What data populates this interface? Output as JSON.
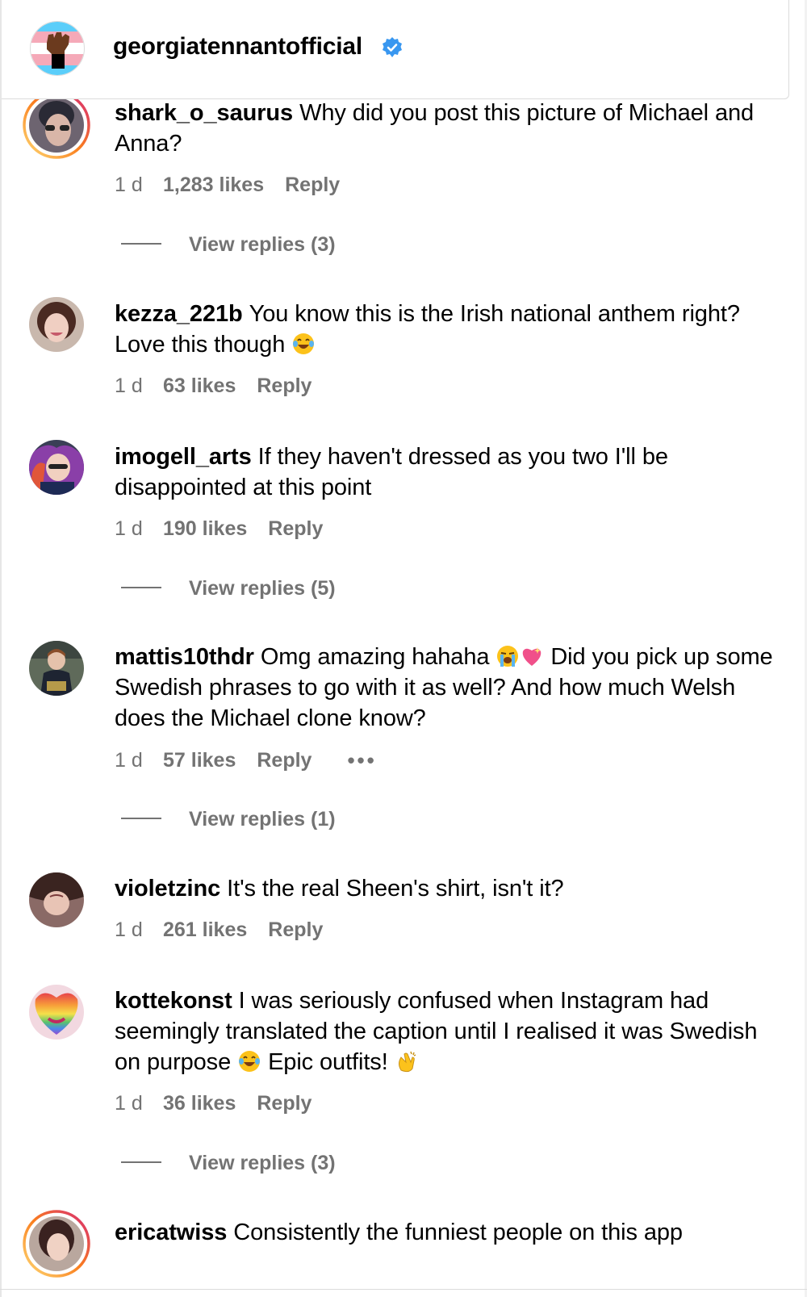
{
  "header": {
    "username": "georgiatennantofficial",
    "verified": true,
    "avatar_icon": "raised-fist-flag-avatar"
  },
  "comments": [
    {
      "username": "shark_o_saurus",
      "text": "Why did you post this picture of Michael and Anna?",
      "time": "1 d",
      "likes": "1,283 likes",
      "reply_label": "Reply",
      "view_replies": "View replies (3)",
      "has_story_ring": true
    },
    {
      "username": "kezza_221b",
      "text": "You know this is the Irish national anthem right? Love this though",
      "emoji": [
        "face-with-tears-of-joy"
      ],
      "time": "1 d",
      "likes": "63 likes",
      "reply_label": "Reply"
    },
    {
      "username": "imogell_arts",
      "text": "If they haven't dressed as you two I'll be disappointed at this point",
      "time": "1 d",
      "likes": "190 likes",
      "reply_label": "Reply",
      "view_replies": "View replies (5)"
    },
    {
      "username": "mattis10thdr",
      "text_before_emoji": "Omg amazing hahaha",
      "emoji": [
        "loudly-crying-face",
        "sparkling-heart"
      ],
      "text_after_emoji": "Did you pick up some Swedish phrases to go with it as well? And how much Welsh does the Michael clone know?",
      "time": "1 d",
      "likes": "57 likes",
      "reply_label": "Reply",
      "more_label": "•••",
      "view_replies": "View replies (1)"
    },
    {
      "username": "violetzinc",
      "text": "It's the real Sheen's shirt, isn't it?",
      "time": "1 d",
      "likes": "261 likes",
      "reply_label": "Reply"
    },
    {
      "username": "kottekonst",
      "text_before_emoji": "I was seriously confused when Instagram had seemingly translated the caption until I realised it was Swedish on purpose",
      "emoji": [
        "face-with-tears-of-joy",
        "clapping-hands"
      ],
      "text_middle": "Epic outfits!",
      "time": "1 d",
      "likes": "36 likes",
      "reply_label": "Reply",
      "view_replies": "View replies (3)"
    },
    {
      "username": "ericatwiss",
      "text": "Consistently the funniest people on this app",
      "has_story_ring": true
    }
  ],
  "colors": {
    "secondary_text": "#737373",
    "verified_blue": "#3897f0",
    "divider": "#dbdbdb",
    "story_ring_start": "#feda75",
    "story_ring_end": "#d62976"
  }
}
